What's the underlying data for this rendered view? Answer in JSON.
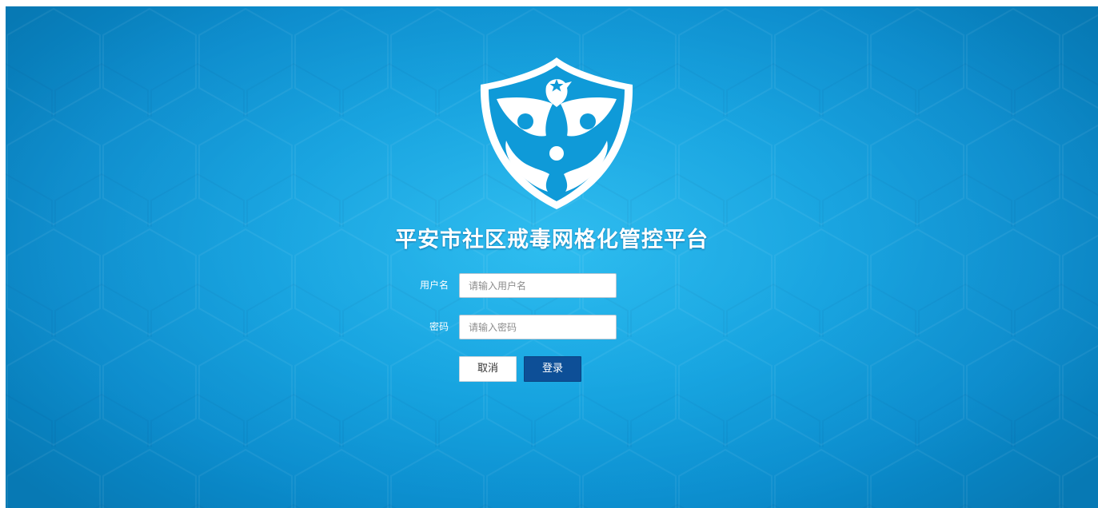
{
  "app": {
    "title": "平安市社区戒毒网格化管控平台"
  },
  "login_form": {
    "username": {
      "label": "用户名",
      "placeholder": "请输入用户名",
      "value": ""
    },
    "password": {
      "label": "密码",
      "placeholder": "请输入密码",
      "value": ""
    },
    "buttons": {
      "cancel_label": "取消",
      "login_label": "登录"
    }
  },
  "icons": {
    "logo": "shield-eagle-hands-emblem-icon"
  },
  "colors": {
    "background": "#0c9fde",
    "background_edge": "#0779b4",
    "login_button": "#0d4f97",
    "text_on_background": "#ffffff"
  }
}
